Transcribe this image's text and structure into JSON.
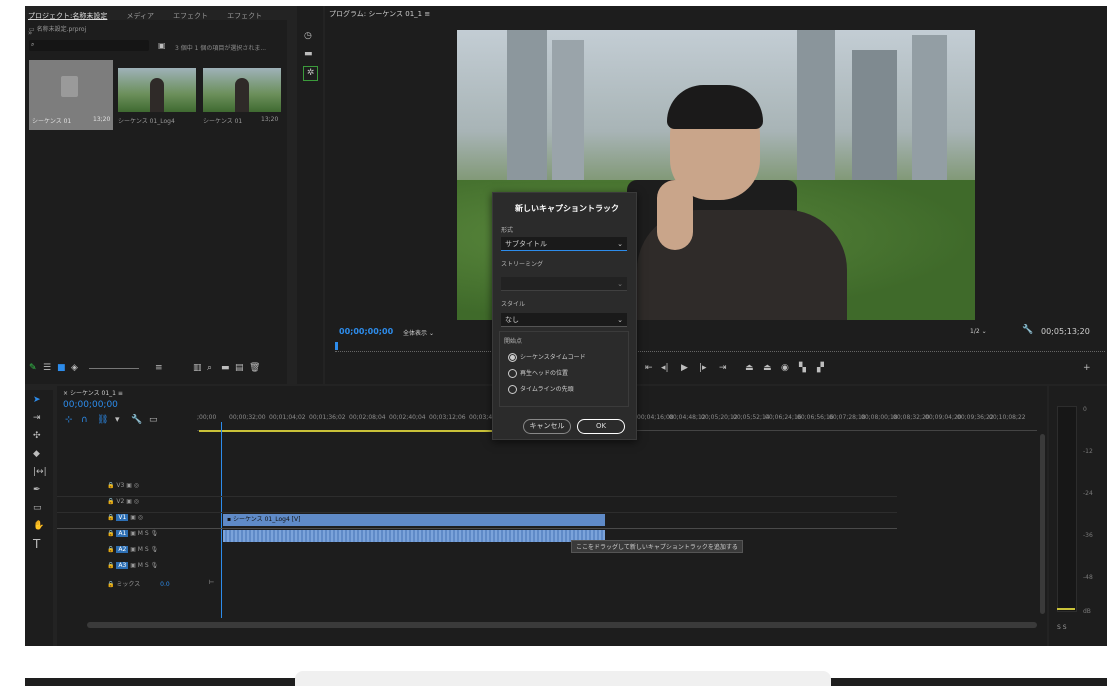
{
  "project": {
    "tabs": [
      "プロジェクト:名称未設定",
      "メディア",
      "エフェクト",
      "エフェクト",
      "»"
    ],
    "file": "名称未設定.prproj",
    "search_placeholder": "",
    "selection_info": "3 個中 1 個の項目が選択されま...",
    "items": [
      {
        "name": "シーケンス 01",
        "duration": "13;20"
      },
      {
        "name": "シーケンス 01_Log4",
        "duration": "13;20"
      },
      {
        "name": "シーケンス 01",
        "duration": "13;20"
      }
    ]
  },
  "program": {
    "tab_label": "プログラム: シーケンス 01_1",
    "timecode_left": "00;00;00;00",
    "fit_label": "全体表示",
    "quality_label": "1/2",
    "timecode_right": "00;05;13;20"
  },
  "dialog": {
    "title": "新しいキャプショントラック",
    "format_label": "形式",
    "format_value": "サブタイトル",
    "streaming_label": "ストリーミング",
    "style_label": "スタイル",
    "style_value": "なし",
    "start_label": "開始点",
    "options": [
      "シーケンスタイムコード",
      "再生ヘッドの位置",
      "タイムラインの先頭"
    ],
    "selected_option": 0,
    "cancel_label": "キャンセル",
    "ok_label": "OK"
  },
  "timeline": {
    "tab_label": "シーケンス 01_1",
    "timecode": "00;00;00;00",
    "ruler_labels": [
      ";00;00",
      "00;00;32;00",
      "00;01;04;02",
      "00;01;36;02",
      "00;02;08;04",
      "00;02;40;04",
      "00;03;12;06",
      "00;03;44;06"
    ],
    "ruler_labels_right": [
      "00;04;16;08",
      "00;04;48;12",
      "00;05;20;12",
      "00;05;52;14",
      "00;06;24;16",
      "00;06;56;16",
      "00;07;28;18",
      "00;08;00;18",
      "00;08;32;20",
      "00;09;04;20",
      "00;09;36;22",
      "00;10;08;22"
    ],
    "video_tracks": [
      "V3",
      "V2",
      "V1"
    ],
    "audio_tracks": [
      "A1",
      "A2",
      "A3"
    ],
    "mix_label": "ミックス",
    "mix_value": "0.0",
    "clip_label": "シーケンス 01_Log4 [V]",
    "tooltip": "ここをドラッグして新しいキャプショントラックを追加する"
  },
  "meter": {
    "labels": [
      "0",
      "-6",
      "-12",
      "-18",
      "-24",
      "-30",
      "-36",
      "-42",
      "-48",
      "-54",
      "dB"
    ]
  },
  "colors": {
    "accent_blue": "#2d8ceb",
    "clip_blue": "#5f8ac7",
    "playhead": "#2d8ceb",
    "panel_bg": "#1d1d1d",
    "dialog_bg": "#2b2b2b"
  }
}
